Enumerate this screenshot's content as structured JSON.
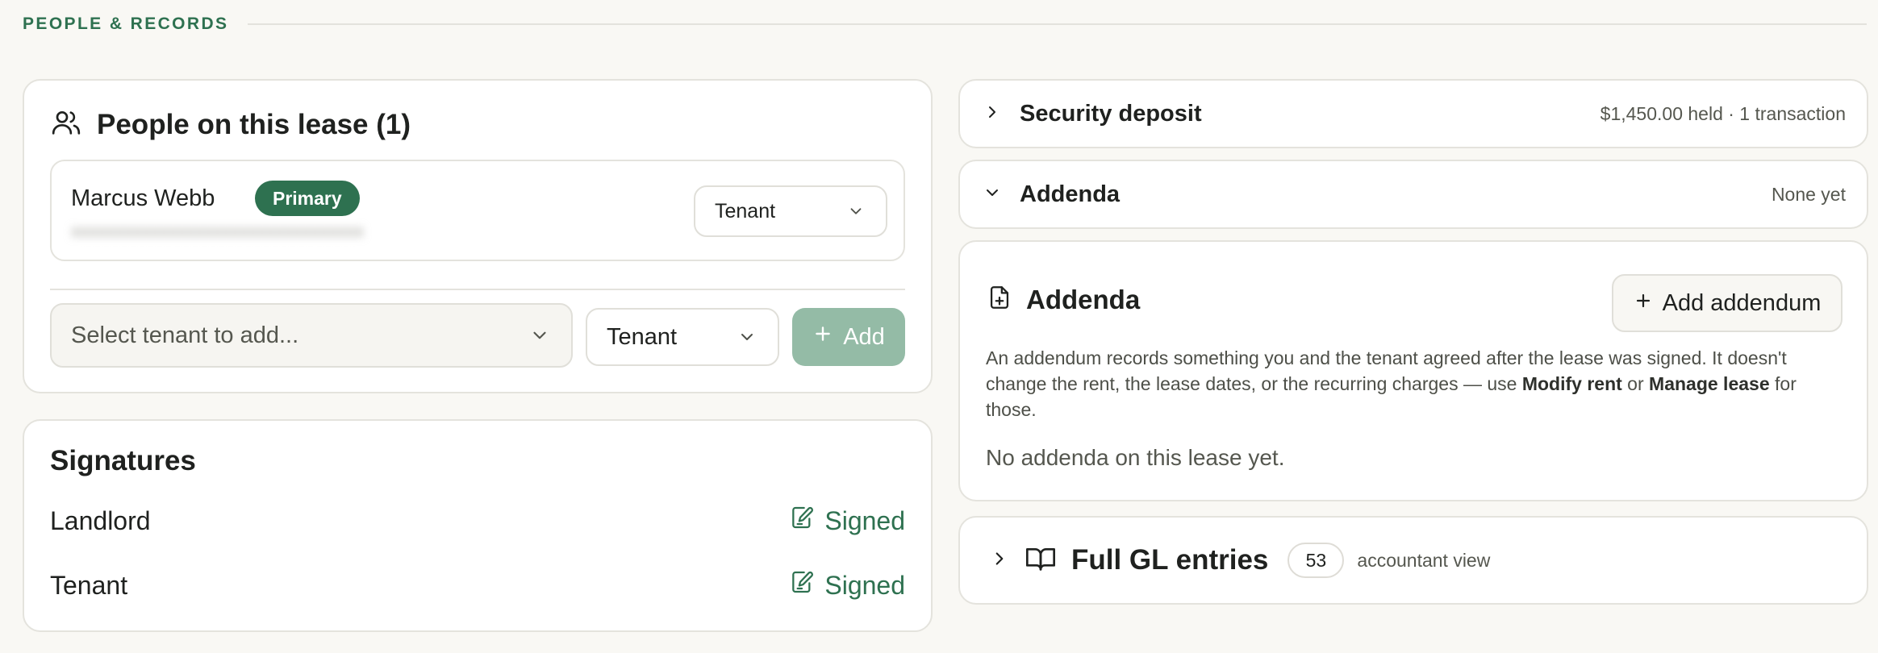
{
  "section": {
    "title": "PEOPLE & RECORDS"
  },
  "people": {
    "title": "People on this lease (1)",
    "person": {
      "name": "Marcus Webb",
      "badge": "Primary",
      "role": "Tenant"
    },
    "add_row": {
      "tenant_placeholder": "Select tenant to add...",
      "role": "Tenant",
      "add_label": "Add"
    }
  },
  "signatures": {
    "title": "Signatures",
    "rows": [
      {
        "label": "Landlord",
        "status": "Signed"
      },
      {
        "label": "Tenant",
        "status": "Signed"
      }
    ]
  },
  "security_deposit": {
    "title": "Security deposit",
    "meta": "$1,450.00 held · 1 transaction"
  },
  "addenda_row": {
    "title": "Addenda",
    "meta": "None yet"
  },
  "addenda_panel": {
    "title": "Addenda",
    "add_button": "Add addendum",
    "desc_part1": "An addendum records something you and the tenant agreed after the lease was signed. It doesn't change the rent, the lease dates, or the recurring charges — use ",
    "desc_link1": "Modify rent",
    "desc_or": " or ",
    "desc_link2": "Manage lease",
    "desc_end": " for those.",
    "empty": "No addenda on this lease yet."
  },
  "gl": {
    "title": "Full GL entries",
    "count": "53",
    "note": "accountant view"
  },
  "colors": {
    "accent": "#2e7150",
    "accent_disabled": "#94bba6",
    "background": "#f9f8f4"
  }
}
